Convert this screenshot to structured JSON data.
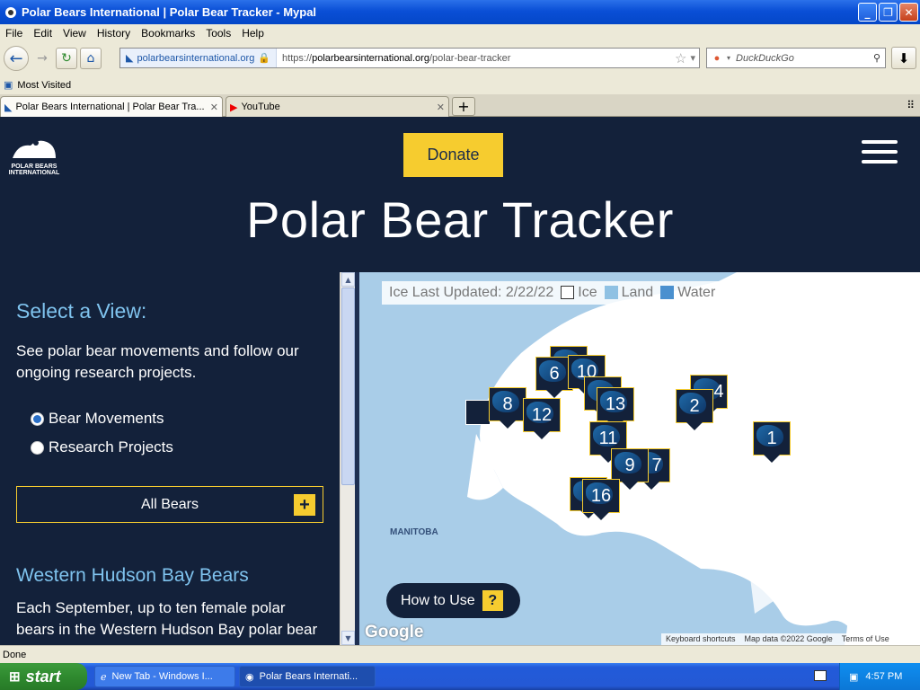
{
  "window": {
    "title": "Polar Bears International | Polar Bear Tracker - Mypal"
  },
  "menu": [
    "File",
    "Edit",
    "View",
    "History",
    "Bookmarks",
    "Tools",
    "Help"
  ],
  "urlbar": {
    "site": "polarbearsinternational.org",
    "url_prefix": "https://",
    "url_host": "polarbearsinternational.org",
    "url_path": "/polar-bear-tracker"
  },
  "search": {
    "placeholder": "DuckDuckGo"
  },
  "bookmarks": {
    "most_visited": "Most Visited"
  },
  "tabs": [
    {
      "label": "Polar Bears International | Polar Bear Tra..."
    },
    {
      "label": "YouTube"
    }
  ],
  "header": {
    "logo_text": "POLAR BEARS INTERNATIONAL",
    "donate": "Donate",
    "title": "Polar Bear Tracker"
  },
  "sidebar": {
    "title": "Select a View:",
    "description": "See polar bear movements and follow our ongoing research projects.",
    "options": [
      {
        "label": "Bear Movements",
        "selected": true
      },
      {
        "label": "Research Projects",
        "selected": false
      }
    ],
    "dropdown": "All Bears",
    "subtitle": "Western Hudson Bay Bears",
    "paragraph": "Each September, up to ten female polar bears in the Western Hudson Bay polar bear"
  },
  "map": {
    "legend": {
      "updated": "Ice Last Updated: 2/22/22",
      "ice": "Ice",
      "land": "Land",
      "water": "Water"
    },
    "colors": {
      "ice": "#ffffff",
      "land": "#8fc1e3",
      "water": "#4a90cf"
    },
    "place_label": "MANITOBA",
    "how_to": "How to Use",
    "google": "Google",
    "footer": [
      "Keyboard shortcuts",
      "Map data ©2022 Google",
      "Terms of Use"
    ],
    "markers": [
      "6",
      "10",
      "8",
      "12",
      "13",
      "2",
      "4",
      "11",
      "1",
      "9",
      "7",
      "16"
    ]
  },
  "status": "Done",
  "taskbar": {
    "start": "start",
    "tasks": [
      "New Tab - Windows I...",
      "Polar Bears Internati..."
    ],
    "time": "4:57 PM"
  }
}
